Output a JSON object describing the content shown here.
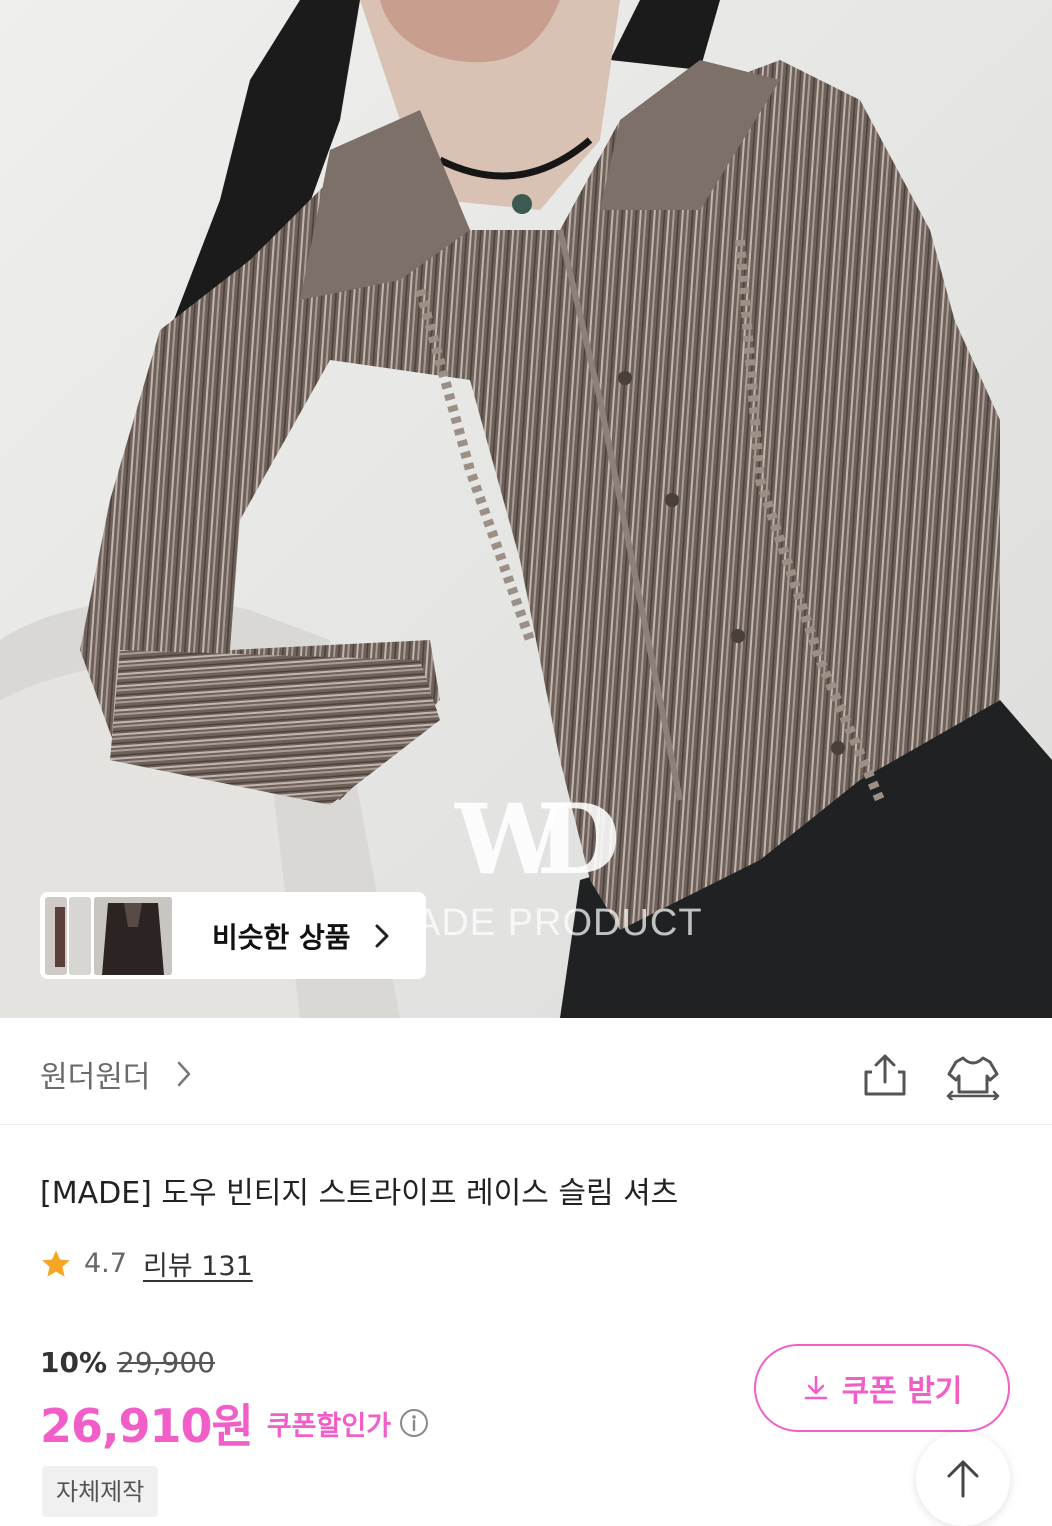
{
  "hero": {
    "watermark_logo": "WD",
    "watermark_text": "ADE PRODUCT",
    "similar_products_label": "비슷한 상품"
  },
  "brand": {
    "name": "원더원더"
  },
  "product": {
    "title": "[MADE] 도우 빈티지 스트라이프 레이스 슬림 셔츠",
    "rating": "4.7",
    "review_label": "리뷰 131",
    "discount_percent": "10%",
    "original_price": "29,900",
    "sale_price": "26,910원",
    "coupon_price_label": "쿠폰할인가",
    "coupon_button_label": "쿠폰 받기",
    "tag": "자체제작"
  },
  "colors": {
    "accent": "#f15ec8",
    "star": "#f5a623",
    "shirt": "#6d6159"
  },
  "icons": {
    "share": "share-icon",
    "try_on": "shirt-icon",
    "info": "info-icon",
    "download": "download-icon",
    "scroll_top": "arrow-up-icon",
    "star": "star-icon",
    "chevron": "chevron-right-icon"
  }
}
